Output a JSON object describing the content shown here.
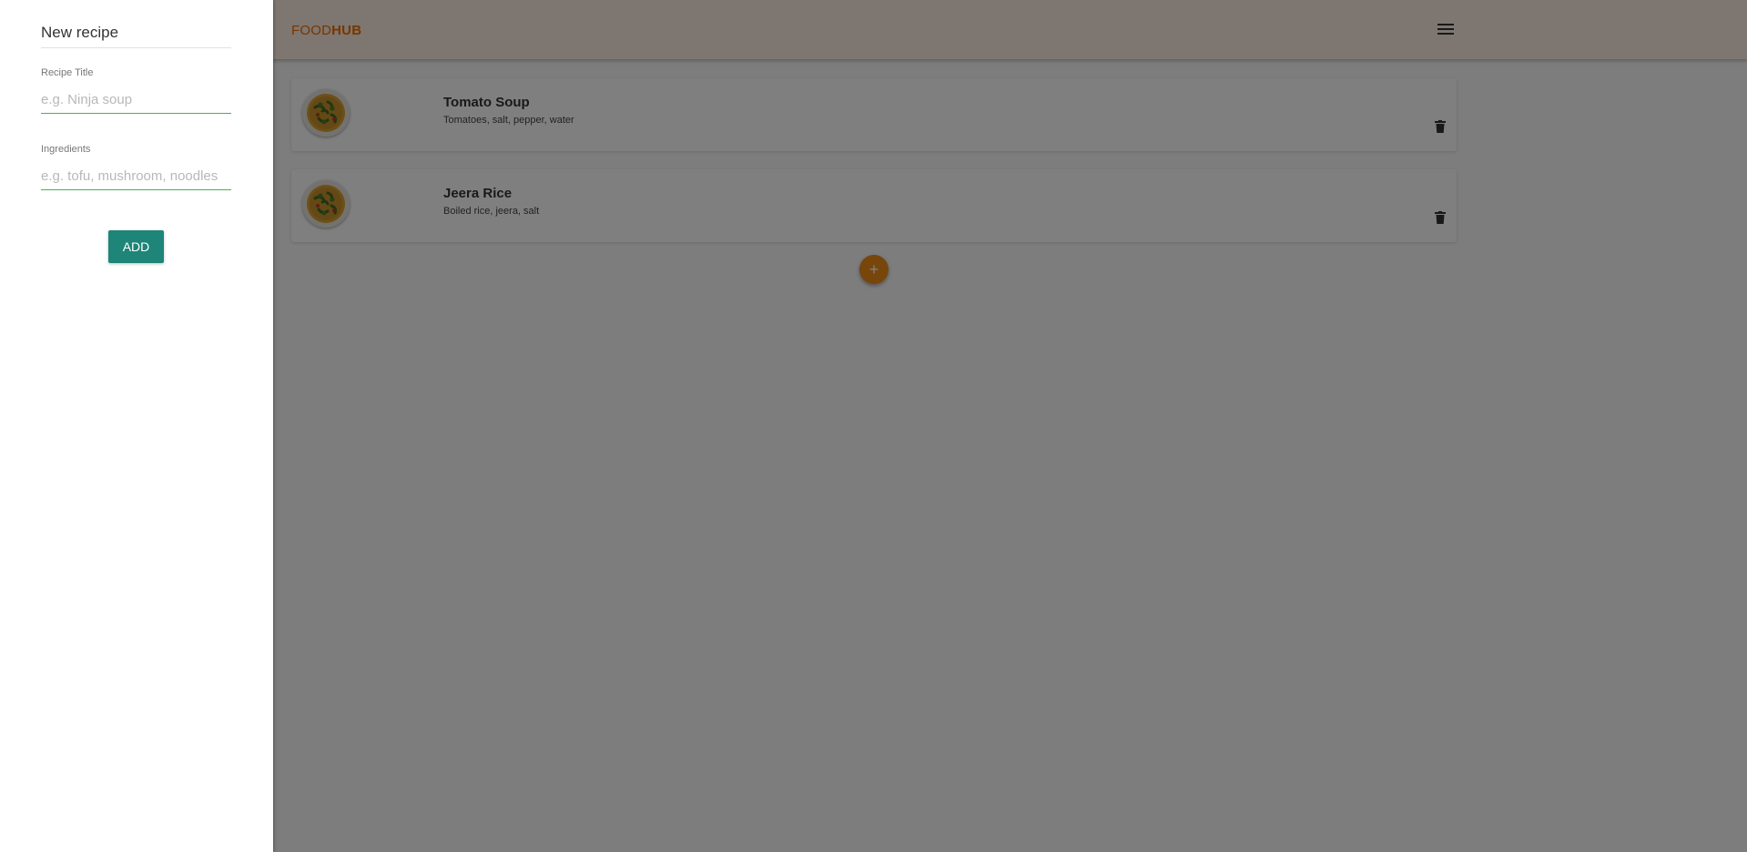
{
  "brand": {
    "part1": "FOOD",
    "part2": "HUB",
    "color": "#ef6c00"
  },
  "navbar": {
    "background": "#fcede0",
    "menu_icon": "hamburger-menu-icon"
  },
  "recipes": [
    {
      "title": "Tomato Soup",
      "ingredients": "Tomatoes, salt, pepper, water",
      "image_icon": "dish-image",
      "delete_icon": "trash-icon"
    },
    {
      "title": "Jeera Rice",
      "ingredients": "Boiled rice, jeera, salt",
      "image_icon": "dish-image",
      "delete_icon": "trash-icon"
    }
  ],
  "fab": {
    "label": "+",
    "color": "#f08a16"
  },
  "drawer": {
    "title": "New recipe",
    "title_field": {
      "label": "Recipe Title",
      "placeholder": "e.g. Ninja soup",
      "value": ""
    },
    "ingredients_field": {
      "label": "Ingredients",
      "placeholder": "e.g. tofu, mushroom, noodles",
      "value": ""
    },
    "add_label": "ADD",
    "add_color": "#1e8578"
  }
}
